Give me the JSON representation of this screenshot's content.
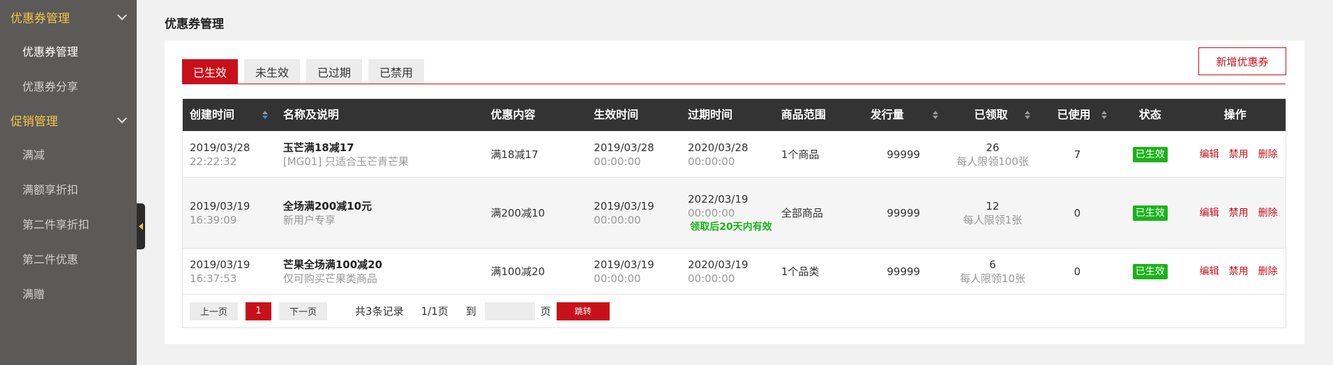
{
  "sidebar": {
    "groups": [
      {
        "label": "优惠券管理",
        "items": [
          "优惠券管理",
          "优惠券分享"
        ]
      },
      {
        "label": "促销管理",
        "items": [
          "满减",
          "满额享折扣",
          "第二件享折扣",
          "第二件优惠",
          "满赠"
        ]
      }
    ]
  },
  "page": {
    "title": "优惠券管理"
  },
  "tabs": [
    "已生效",
    "未生效",
    "已过期",
    "已禁用"
  ],
  "add_button": "新增优惠券",
  "table": {
    "headers": [
      "创建时间",
      "名称及说明",
      "优惠内容",
      "生效时间",
      "过期时间",
      "商品范围",
      "发行量",
      "已领取",
      "已使用",
      "状态",
      "操作"
    ],
    "rows": [
      {
        "created_date": "2019/03/28",
        "created_time": "22:22:32",
        "name": "玉芒满18减17",
        "desc": "[MG01] 只适合玉芒青芒果",
        "discount": "满18减17",
        "start_date": "2019/03/28",
        "start_time": "00:00:00",
        "end_date": "2020/03/28",
        "end_time": "00:00:00",
        "end_note": "",
        "scope": "1个商品",
        "issued": "99999",
        "claimed": "26",
        "claim_limit": "每人限领100张",
        "used": "7",
        "status": "已生效",
        "ops": [
          "编辑",
          "禁用",
          "删除"
        ]
      },
      {
        "created_date": "2019/03/19",
        "created_time": "16:39:09",
        "name": "全场满200减10元",
        "desc": "新用户专享",
        "discount": "满200减10",
        "start_date": "2019/03/19",
        "start_time": "00:00:00",
        "end_date": "2022/03/19",
        "end_time": "00:00:00",
        "end_note": "领取后20天内有效",
        "scope": "全部商品",
        "issued": "99999",
        "claimed": "12",
        "claim_limit": "每人限领1张",
        "used": "0",
        "status": "已生效",
        "ops": [
          "编辑",
          "禁用",
          "删除"
        ]
      },
      {
        "created_date": "2019/03/19",
        "created_time": "16:37:53",
        "name": "芒果全场满100减20",
        "desc": "仅可购买芒果类商品",
        "discount": "满100减20",
        "start_date": "2019/03/19",
        "start_time": "00:00:00",
        "end_date": "2020/03/19",
        "end_time": "00:00:00",
        "end_note": "",
        "scope": "1个品类",
        "issued": "99999",
        "claimed": "6",
        "claim_limit": "每人限领10张",
        "used": "0",
        "status": "已生效",
        "ops": [
          "编辑",
          "禁用",
          "删除"
        ]
      }
    ]
  },
  "pager": {
    "prev": "上一页",
    "current": "1",
    "next": "下一页",
    "total": "共3条记录",
    "pages": "1/1页",
    "to": "到",
    "page_unit": "页",
    "jump": "跳转"
  },
  "colors": {
    "accent": "#c8101b",
    "sidebar_bg": "#5b5a58",
    "sidebar_group": "#f6c342",
    "status_green": "#1bb31b"
  }
}
